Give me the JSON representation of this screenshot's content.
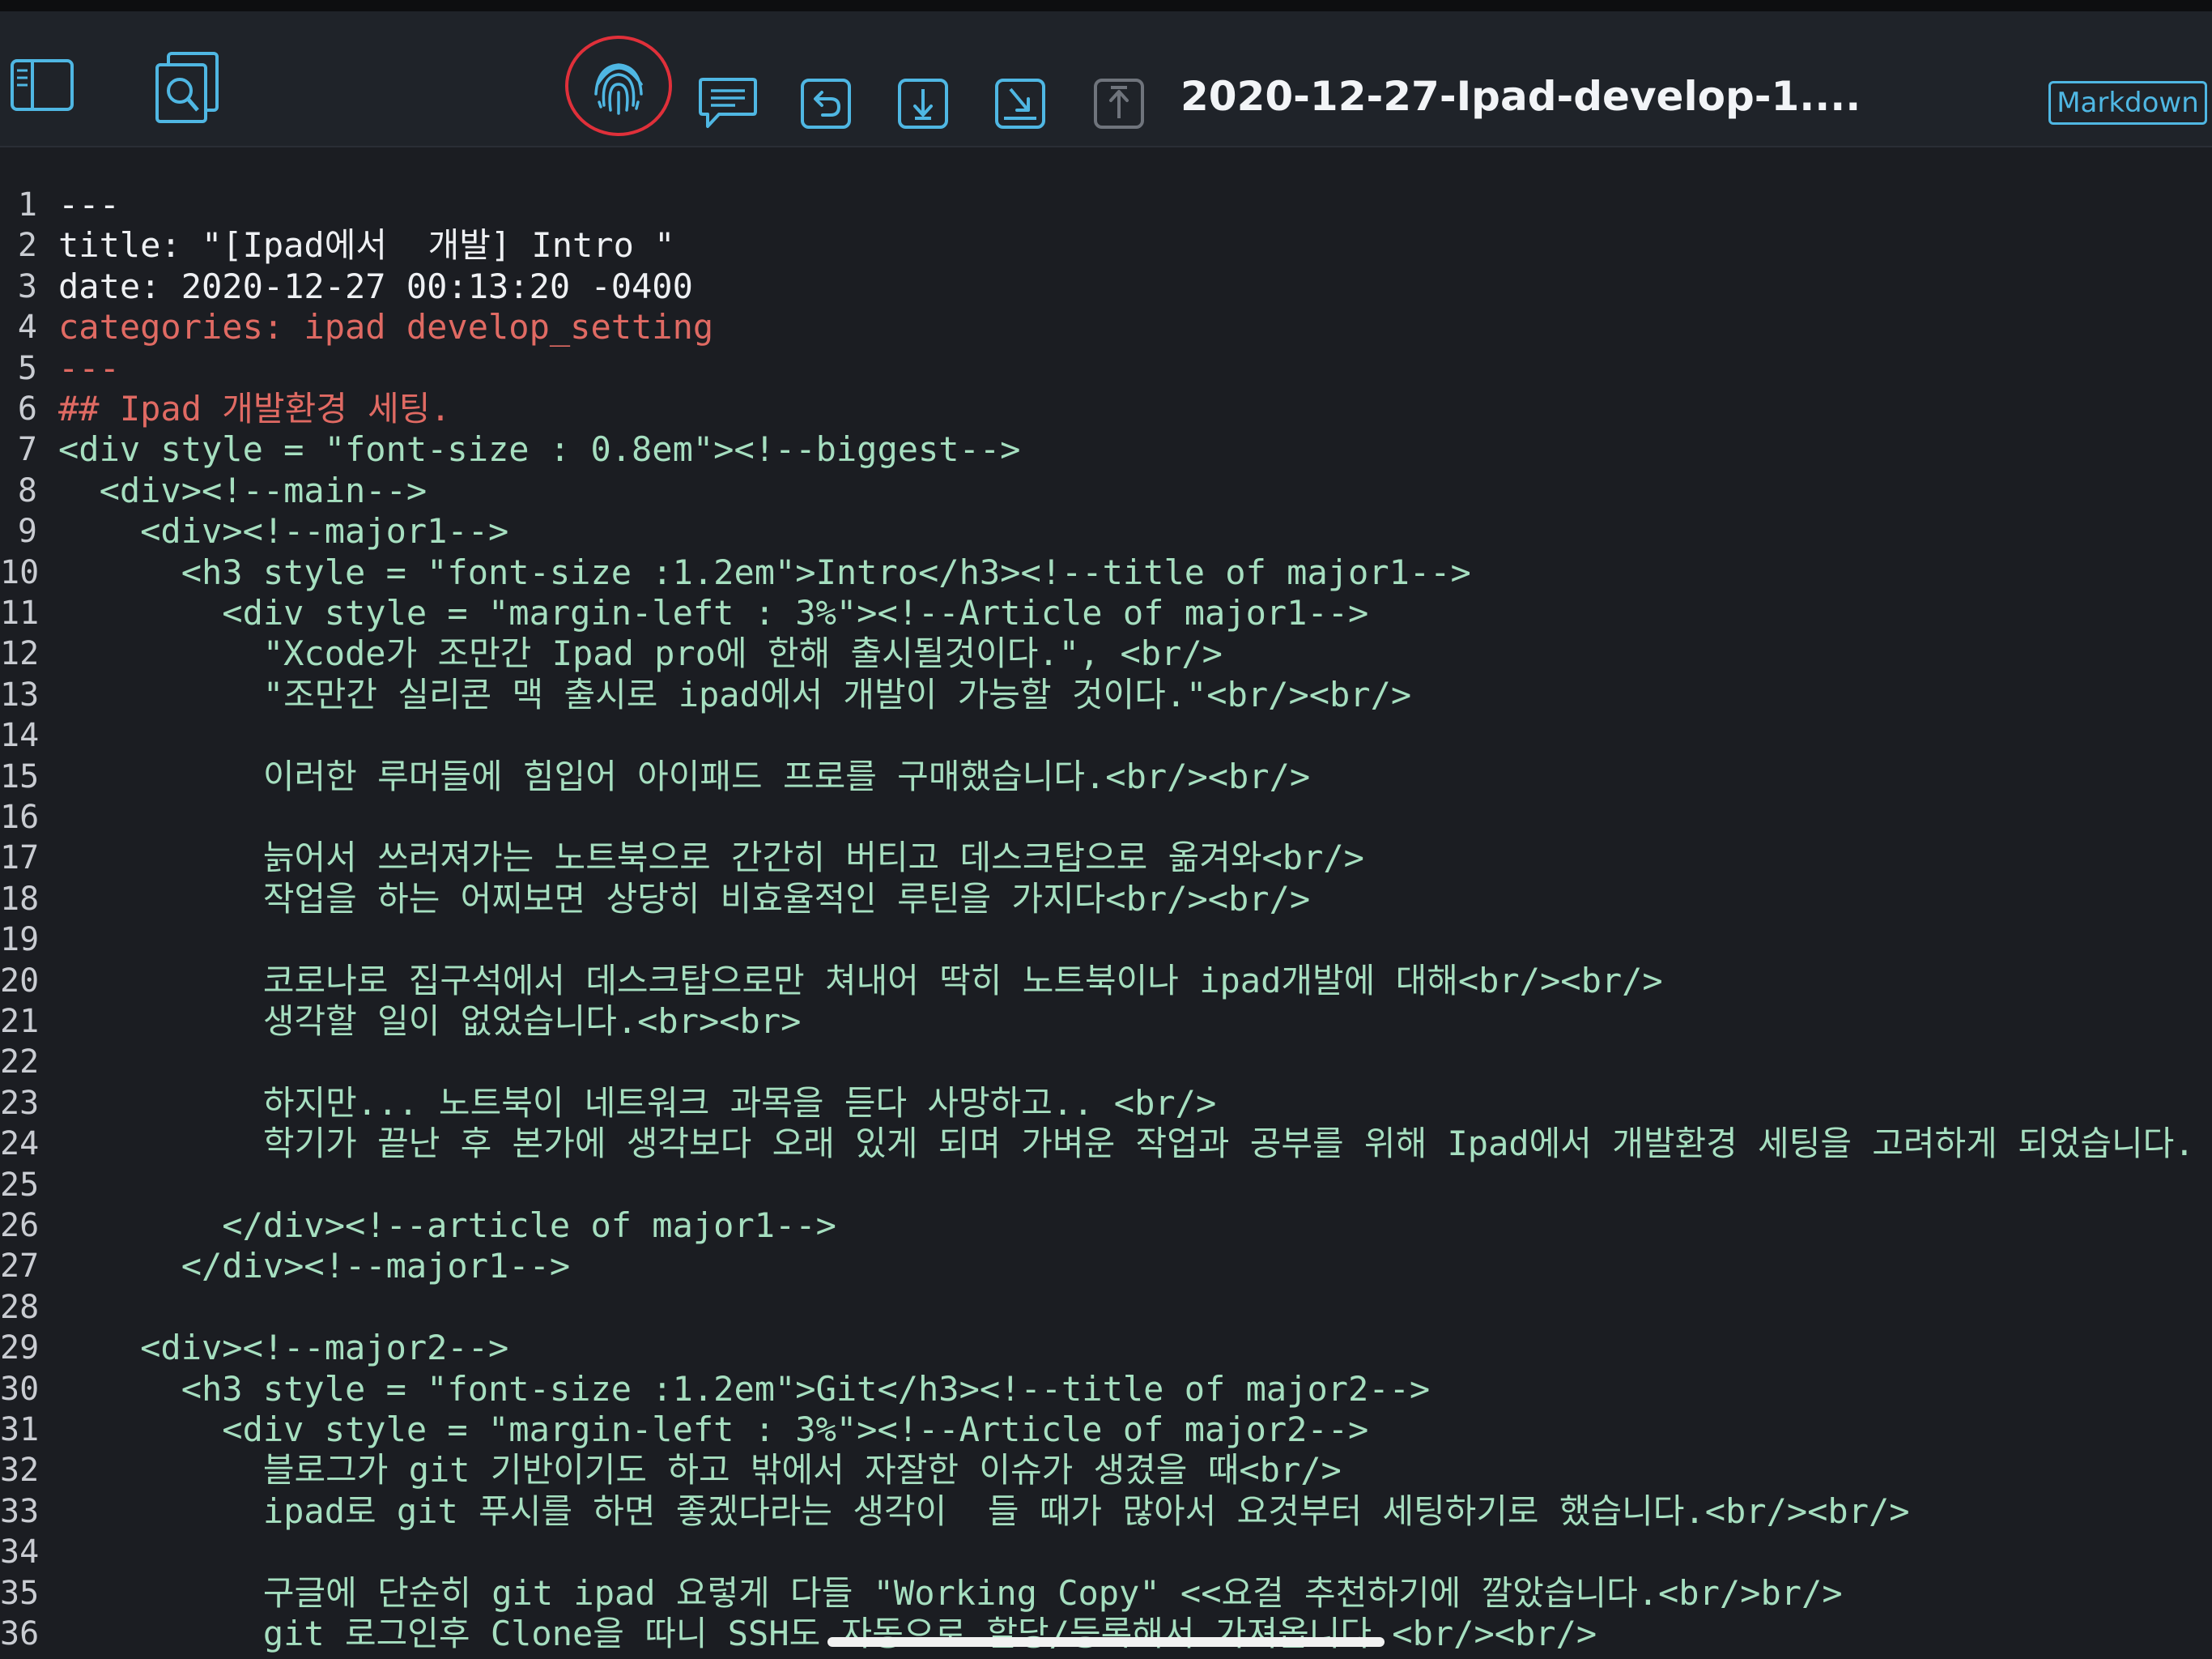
{
  "toolbar": {
    "file_title": "2020-12-27-Ipad-develop-1....",
    "mode_label": "Markdown",
    "icons": [
      "sidebar-toggle-icon",
      "document-search-icon",
      "fingerprint-icon",
      "comment-icon",
      "undo-icon",
      "download-icon",
      "save-to-device-icon",
      "upload-icon"
    ],
    "highlight_color": "#e0303a"
  },
  "editor": {
    "lines": [
      {
        "n": "1",
        "text": "---"
      },
      {
        "n": "2",
        "text": "title: \"[Ipad에서  개발] Intro \""
      },
      {
        "n": "3",
        "text": "date: 2020-12-27 00:13:20 -0400"
      },
      {
        "n": "4",
        "text": "categories: ipad develop_setting"
      },
      {
        "n": "5",
        "text": "---"
      },
      {
        "n": "6",
        "text": "## Ipad 개발환경 세팅."
      },
      {
        "n": "7",
        "text": "<div style = \"font-size : 0.8em\"><!--biggest-->"
      },
      {
        "n": "8",
        "text": "  <div><!--main-->"
      },
      {
        "n": "9",
        "text": "    <div><!--major1-->"
      },
      {
        "n": "10",
        "text": "      <h3 style = \"font-size :1.2em\">Intro</h3><!--title of major1-->"
      },
      {
        "n": "11",
        "text": "        <div style = \"margin-left : 3%\"><!--Article of major1-->"
      },
      {
        "n": "12",
        "text": "          \"Xcode가 조만간 Ipad pro에 한해 출시될것이다.\", <br/>"
      },
      {
        "n": "13",
        "text": "          \"조만간 실리콘 맥 출시로 ipad에서 개발이 가능할 것이다.\"<br/><br/>"
      },
      {
        "n": "14",
        "text": ""
      },
      {
        "n": "15",
        "text": "          이러한 루머들에 힘입어 아이패드 프로를 구매했습니다.<br/><br/>"
      },
      {
        "n": "16",
        "text": ""
      },
      {
        "n": "17",
        "text": "          늙어서 쓰러져가는 노트북으로 간간히 버티고 데스크탑으로 옮겨와<br/>"
      },
      {
        "n": "18",
        "text": "          작업을 하는 어찌보면 상당히 비효율적인 루틴을 가지다<br/><br/>"
      },
      {
        "n": "19",
        "text": ""
      },
      {
        "n": "20",
        "text": "          코로나로 집구석에서 데스크탑으로만 쳐내어 딱히 노트북이나 ipad개발에 대해<br/><br/>"
      },
      {
        "n": "21",
        "text": "          생각할 일이 없었습니다.<br><br>"
      },
      {
        "n": "22",
        "text": ""
      },
      {
        "n": "23",
        "text": "          하지만... 노트북이 네트워크 과목을 듣다 사망하고.. <br/>"
      },
      {
        "n": "24",
        "text": "          학기가 끝난 후 본가에 생각보다 오래 있게 되며 가벼운 작업과 공부를 위해 Ipad에서 개발환경 세팅을 고려하게 되었습니다."
      },
      {
        "n": "25",
        "text": ""
      },
      {
        "n": "26",
        "text": "        </div><!--article of major1-->"
      },
      {
        "n": "27",
        "text": "      </div><!--major1-->"
      },
      {
        "n": "28",
        "text": ""
      },
      {
        "n": "29",
        "text": "    <div><!--major2-->"
      },
      {
        "n": "30",
        "text": "      <h3 style = \"font-size :1.2em\">Git</h3><!--title of major2-->"
      },
      {
        "n": "31",
        "text": "        <div style = \"margin-left : 3%\"><!--Article of major2-->"
      },
      {
        "n": "32",
        "text": "          블로그가 git 기반이기도 하고 밖에서 자잘한 이슈가 생겼을 때<br/>"
      },
      {
        "n": "33",
        "text": "          ipad로 git 푸시를 하면 좋겠다라는 생각이  들 때가 많아서 요것부터 세팅하기로 했습니다.<br/><br/>"
      },
      {
        "n": "34",
        "text": ""
      },
      {
        "n": "35",
        "text": "          구글에 단순히 git ipad 요렇게 다들 \"Working Copy\" <<요걸 추천하기에 깔았습니다.<br/>br/>"
      },
      {
        "n": "36",
        "text": "          git 로그인후 Clone을 따니 SSH도 자동으로 할당/등록해서 가져옵니다 <br/><br/>"
      }
    ]
  }
}
